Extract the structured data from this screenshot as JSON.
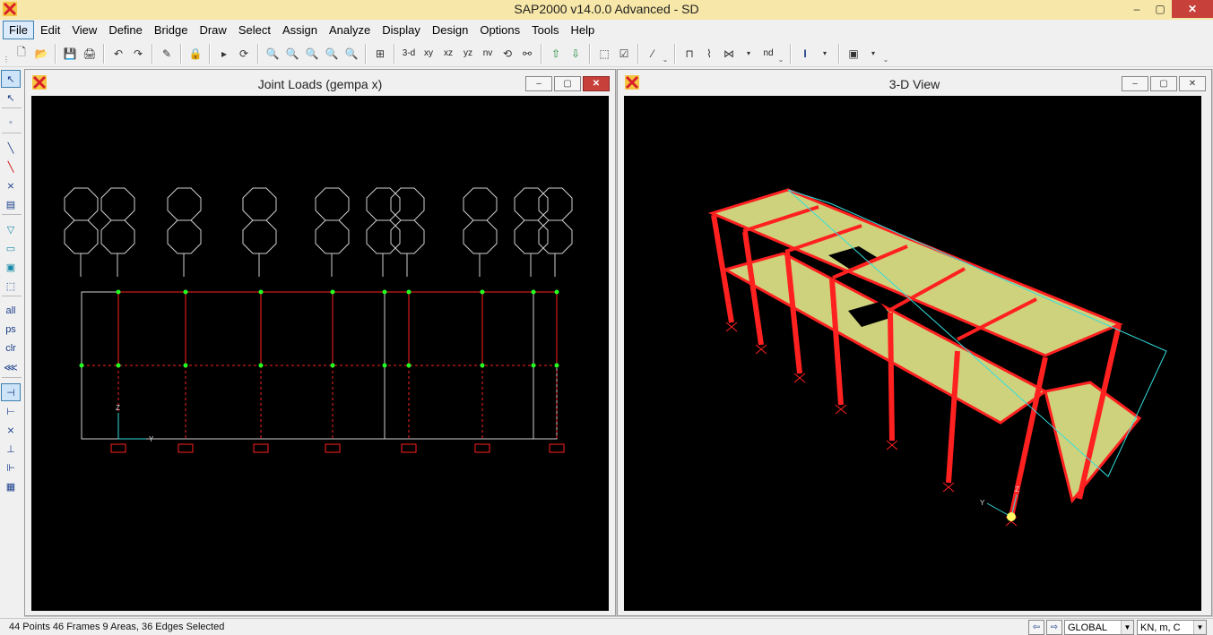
{
  "window": {
    "title": "SAP2000 v14.0.0 Advanced  - SD",
    "minimize": "–",
    "maximize": "▢",
    "close": "✕"
  },
  "menu": {
    "items": [
      "File",
      "Edit",
      "View",
      "Define",
      "Bridge",
      "Draw",
      "Select",
      "Assign",
      "Analyze",
      "Display",
      "Design",
      "Options",
      "Tools",
      "Help"
    ]
  },
  "toolbar": {
    "view_3d": "3-d",
    "view_xy": "xy",
    "view_xz": "xz",
    "view_yz": "yz",
    "view_nv": "nv",
    "view_nd": "nd"
  },
  "lefttoolbar": {
    "all": "all",
    "ps": "ps",
    "clr": "clr"
  },
  "windows": {
    "joint_loads": {
      "title": "Joint Loads (gempa x)",
      "axis_x": "Y",
      "axis_z": "Z"
    },
    "view_3d": {
      "title": "3-D View",
      "axis_x": "Y",
      "axis_z": "Z"
    }
  },
  "status": {
    "selection": "44 Points  46 Frames  9 Areas, 36 Edges Selected",
    "coord_system": "GLOBAL",
    "units": "KN, m, C"
  },
  "colors": {
    "titlebar": "#f7e7a8",
    "frame_red": "#ff2020",
    "joint_green": "#22ff22",
    "shell_yellow": "#cfd27c",
    "canvas_bg": "#000000"
  }
}
